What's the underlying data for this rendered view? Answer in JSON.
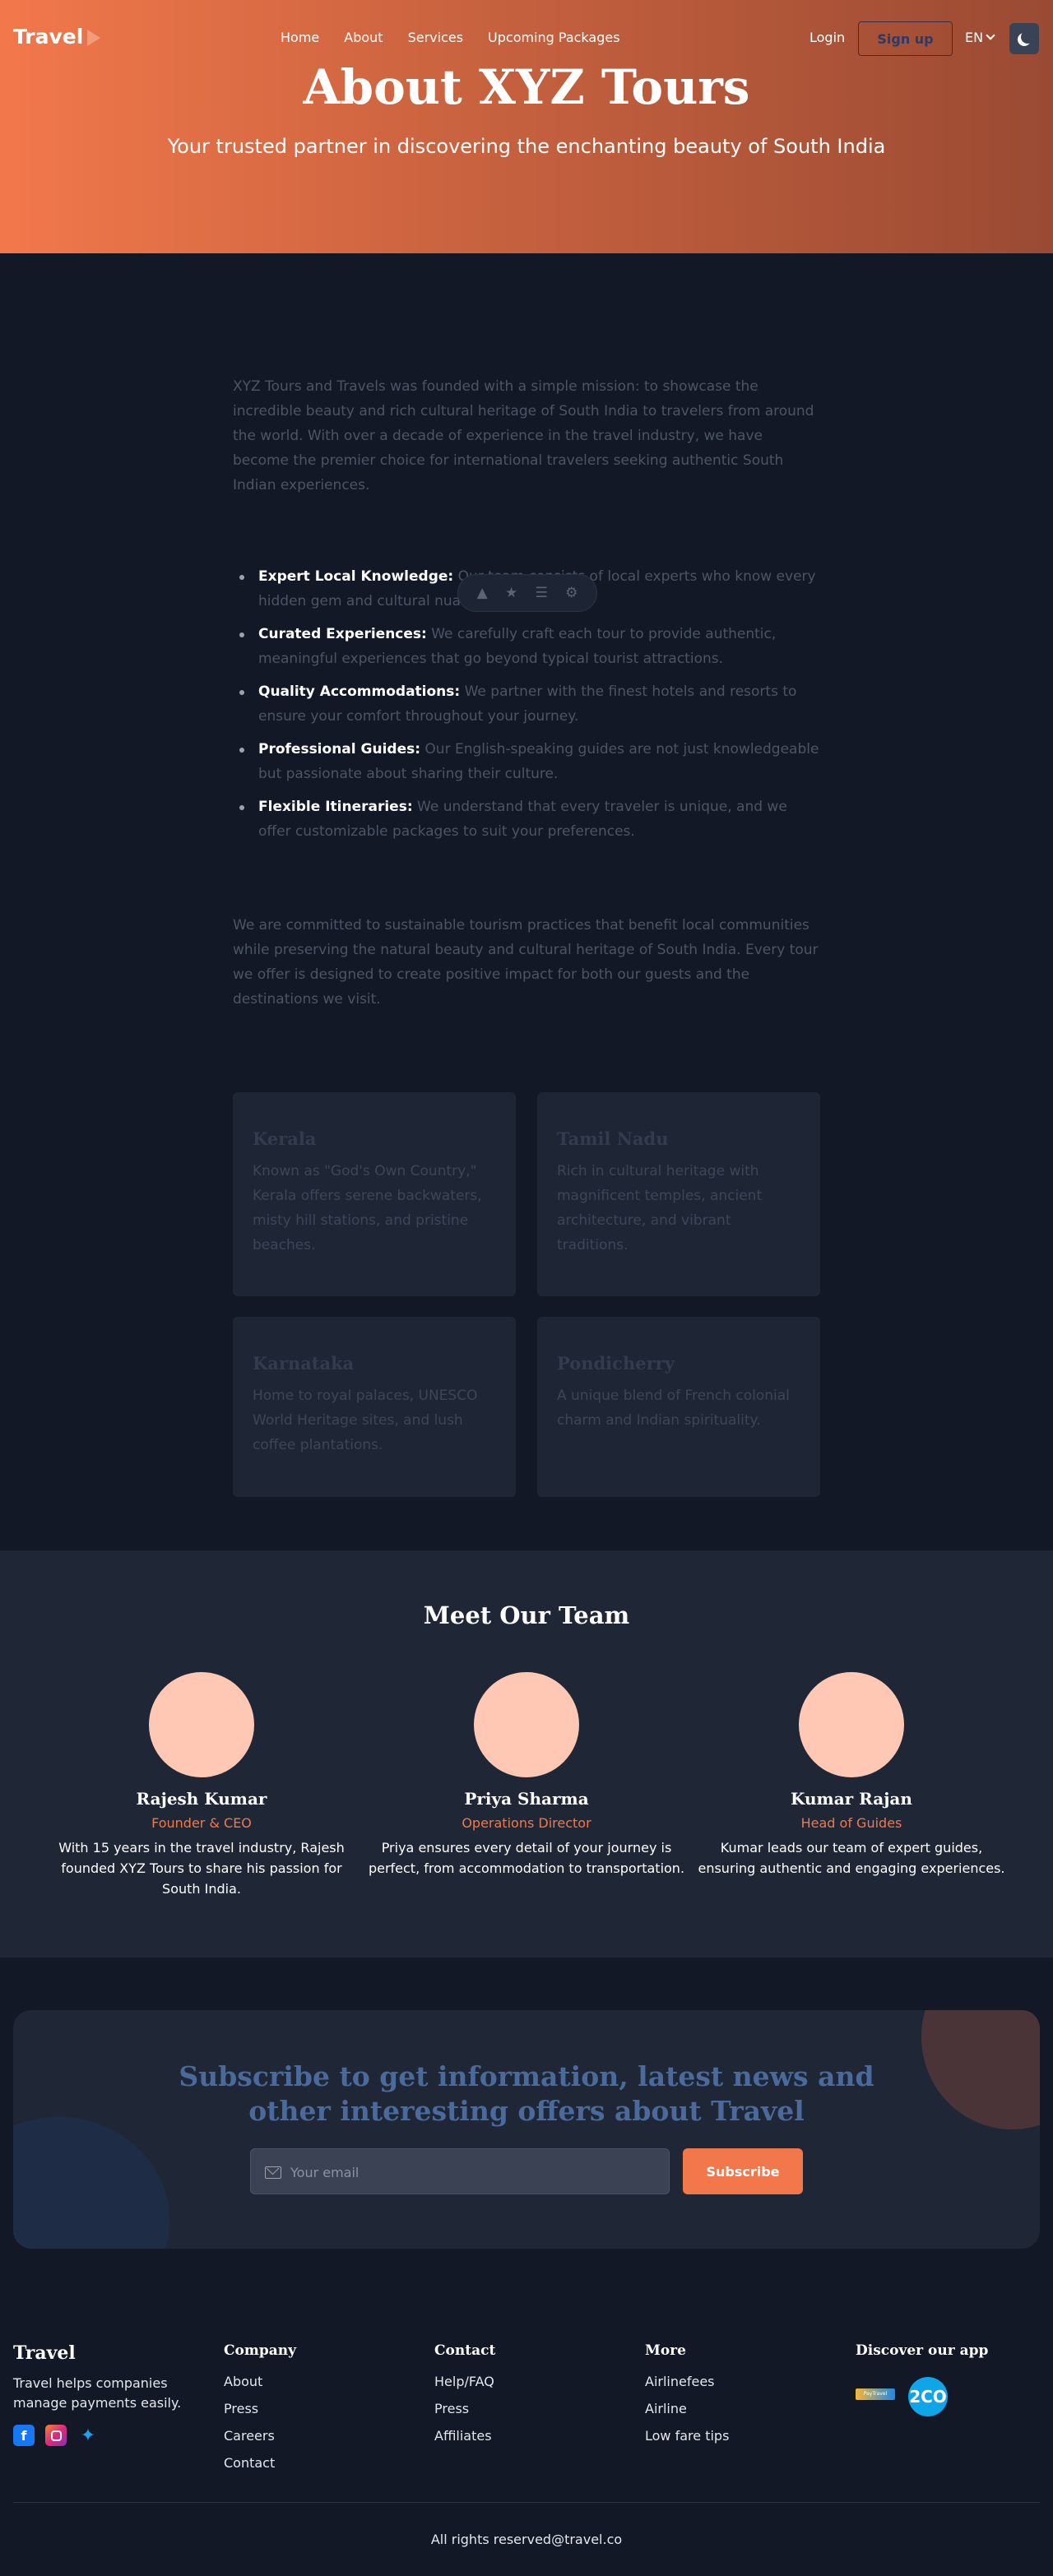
{
  "nav": {
    "logo": "Travel",
    "links": [
      "Home",
      "About",
      "Services",
      "Upcoming Packages"
    ],
    "login": "Login",
    "signup": "Sign up",
    "language": "EN"
  },
  "hero": {
    "title": "About XYZ Tours",
    "subtitle": "Your trusted partner in discovering the enchanting beauty of South India"
  },
  "about": {
    "intro": "XYZ Tours and Travels was founded with a simple mission: to showcase the incredible beauty and rich cultural heritage of South India to travelers from around the world. With over a decade of experience in the travel industry, we have become the premier choice for international travelers seeking authentic South Indian experiences.",
    "features": [
      {
        "title": "Expert Local Knowledge:",
        "text": " Our team consists of local experts who know every hidden gem and cultural nuance of South India."
      },
      {
        "title": "Curated Experiences:",
        "text": " We carefully craft each tour to provide authentic, meaningful experiences that go beyond typical tourist attractions."
      },
      {
        "title": "Quality Accommodations:",
        "text": " We partner with the finest hotels and resorts to ensure your comfort throughout your journey."
      },
      {
        "title": "Professional Guides:",
        "text": " Our English-speaking guides are not just knowledgeable but passionate about sharing their culture."
      },
      {
        "title": "Flexible Itineraries:",
        "text": " We understand that every traveler is unique, and we offer customizable packages to suit your preferences."
      }
    ],
    "commitment": "We are committed to sustainable tourism practices that benefit local communities while preserving the natural beauty and cultural heritage of South India. Every tour we offer is designed to create positive impact for both our guests and the destinations we visit."
  },
  "destinations": [
    {
      "name": "Kerala",
      "text": "Known as \"God's Own Country,\" Kerala offers serene backwaters, misty hill stations, and pristine beaches."
    },
    {
      "name": "Tamil Nadu",
      "text": "Rich in cultural heritage with magnificent temples, ancient architecture, and vibrant traditions."
    },
    {
      "name": "Karnataka",
      "text": "Home to royal palaces, UNESCO World Heritage sites, and lush coffee plantations."
    },
    {
      "name": "Pondicherry",
      "text": "A unique blend of French colonial charm and Indian spirituality."
    }
  ],
  "team": {
    "title": "Meet Our Team",
    "members": [
      {
        "name": "Rajesh Kumar",
        "role": "Founder & CEO",
        "bio": "With 15 years in the travel industry, Rajesh founded XYZ Tours to share his passion for South India."
      },
      {
        "name": "Priya Sharma",
        "role": "Operations Director",
        "bio": "Priya ensures every detail of your journey is perfect, from accommodation to transportation."
      },
      {
        "name": "Kumar Rajan",
        "role": "Head of Guides",
        "bio": "Kumar leads our team of expert guides, ensuring authentic and engaging experiences."
      }
    ]
  },
  "subscribe": {
    "title": "Subscribe to get information, latest news and other interesting offers about Travel",
    "placeholder": "Your email",
    "button": "Subscribe"
  },
  "footer": {
    "logo": "Travel",
    "tagline": "Travel helps companies manage payments easily.",
    "company": {
      "title": "Company",
      "links": [
        "About",
        "Press",
        "Careers",
        "Contact"
      ]
    },
    "contact": {
      "title": "Contact",
      "links": [
        "Help/FAQ",
        "Press",
        "Affiliates"
      ]
    },
    "more": {
      "title": "More",
      "links": [
        "Airlinefees",
        "Airline",
        "Low fare tips"
      ]
    },
    "app": {
      "title": "Discover our app",
      "app1": "PayTravel",
      "app2": "2CO"
    },
    "copyright": "All rights reserved@travel.co"
  },
  "colors": {
    "accent": "#f2784b",
    "background": "#121826",
    "panel": "#1f2736"
  }
}
